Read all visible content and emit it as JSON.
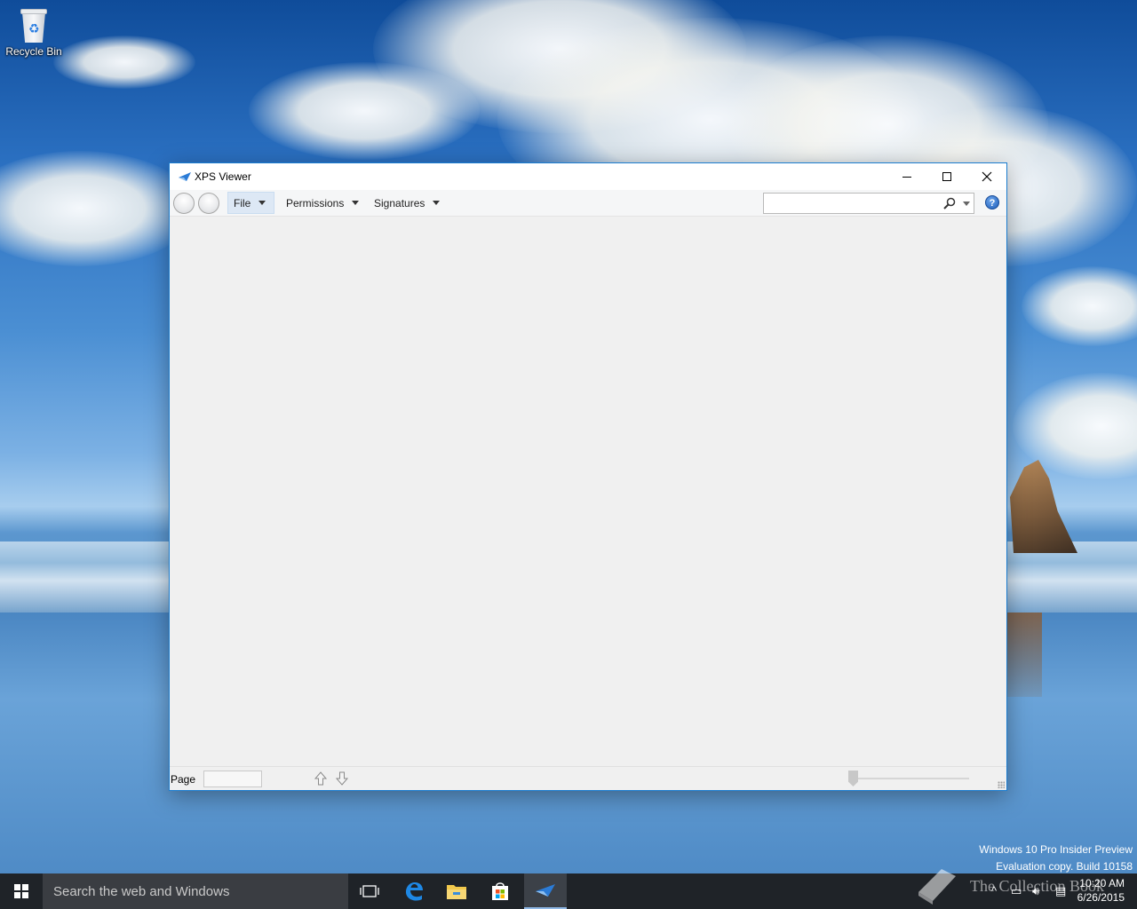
{
  "desktop": {
    "icons": [
      {
        "label": "Recycle Bin",
        "icon": "recycle-bin-icon"
      }
    ],
    "watermark": {
      "line1": "Windows 10 Pro Insider Preview",
      "line2": "Evaluation copy. Build 10158"
    },
    "brand_overlay": "The Collection Book"
  },
  "window": {
    "title": "XPS Viewer",
    "accent": "#1b7dd0",
    "menus": [
      {
        "label": "File",
        "active": true
      },
      {
        "label": "Permissions",
        "active": false
      },
      {
        "label": "Signatures",
        "active": false
      }
    ],
    "search": {
      "value": "",
      "placeholder": ""
    },
    "status": {
      "page_label": "Page",
      "page_value": ""
    }
  },
  "taskbar": {
    "search_placeholder": "Search the web and Windows",
    "clock": {
      "time": "10:20 AM",
      "date": "6/26/2015"
    },
    "pinned": [
      "task-view-icon",
      "edge-icon",
      "file-explorer-icon",
      "store-icon",
      "xps-viewer-icon"
    ]
  }
}
